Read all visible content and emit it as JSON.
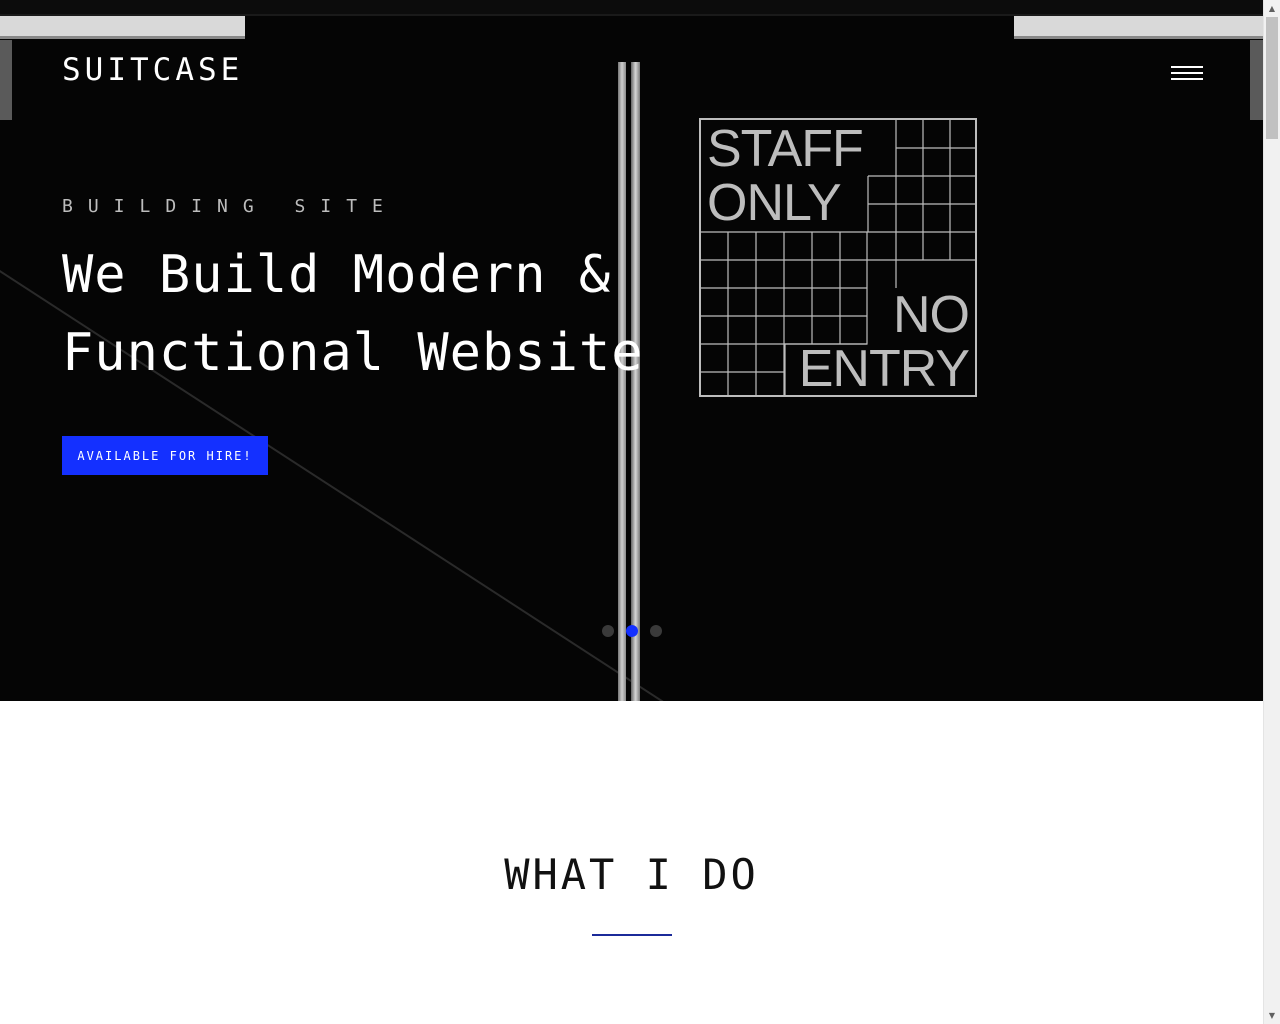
{
  "header": {
    "logo": "SUITCASE",
    "menu_icon": "hamburger-menu-icon"
  },
  "hero": {
    "kicker": "BUILDING SITE",
    "headline": "We Build Modern & Functional Website",
    "cta_label": "AVAILABLE FOR HIRE!",
    "sign": {
      "line1": "STAFF",
      "line2": "ONLY",
      "line3": "NO",
      "line4": "ENTRY"
    },
    "slider": {
      "count": 3,
      "active_index": 1
    }
  },
  "section": {
    "title": "WHAT I DO"
  },
  "colors": {
    "accent": "#1430ff",
    "hero_bg": "#050505",
    "underline": "#1b2a99"
  },
  "scrollbar": {
    "up_icon": "scroll-up-arrow-icon",
    "down_icon": "scroll-down-arrow-icon"
  }
}
